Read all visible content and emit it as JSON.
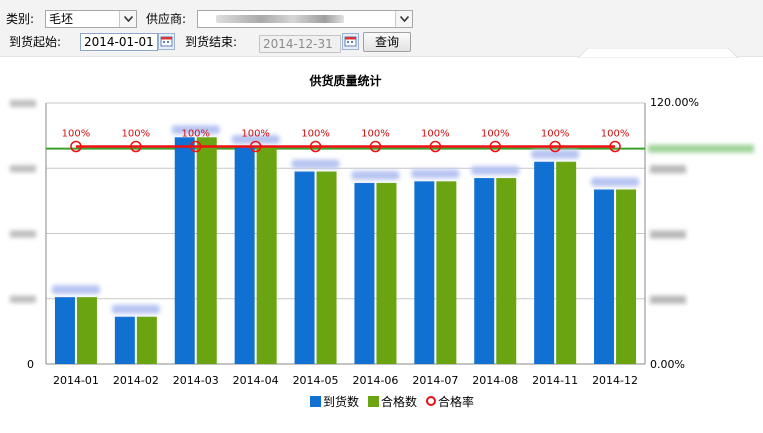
{
  "filters": {
    "category_label": "类别:",
    "category_value": "毛坯",
    "supplier_label": "供应商:",
    "supplier_value": "",
    "start_label": "到货起始:",
    "start_value": "2014-01-01",
    "end_label": "到货结束:",
    "end_value": "2014-12-31",
    "query_button": "查询"
  },
  "colors": {
    "arrivals": "#1171d3",
    "qualified": "#6aa511",
    "rate_line": "#ee1111",
    "target_line": "#3aa02a"
  },
  "chart_data": {
    "type": "bar",
    "title": "供货质量统计",
    "categories": [
      "2014-01",
      "2014-02",
      "2014-03",
      "2014-04",
      "2014-05",
      "2014-06",
      "2014-07",
      "2014-08",
      "2014-11",
      "2014-12"
    ],
    "series": [
      {
        "name": "到货数",
        "values": [
          41,
          29,
          139,
          133,
          118,
          111,
          112,
          114,
          124,
          107
        ]
      },
      {
        "name": "合格数",
        "values": [
          41,
          29,
          139,
          133,
          118,
          111,
          112,
          114,
          124,
          107
        ]
      },
      {
        "name": "合格率",
        "values": [
          100,
          100,
          100,
          100,
          100,
          100,
          100,
          100,
          100,
          100
        ],
        "axis": "right",
        "line": true
      }
    ],
    "rate_labels": [
      "100%",
      "100%",
      "100%",
      "100%",
      "100%",
      "100%",
      "100%",
      "100%",
      "100%",
      "100%"
    ],
    "left_axis": {
      "ylim": [
        0,
        160
      ],
      "tick_labels": [
        "0"
      ]
    },
    "right_axis": {
      "ylim": [
        0,
        120
      ],
      "tick_labels": [
        "0.00%",
        "120.00%"
      ]
    },
    "target_rate": 99,
    "grid": true,
    "legend": {
      "position": "bottom-center",
      "entries": [
        "到货数",
        "合格数",
        "合格率"
      ]
    }
  }
}
